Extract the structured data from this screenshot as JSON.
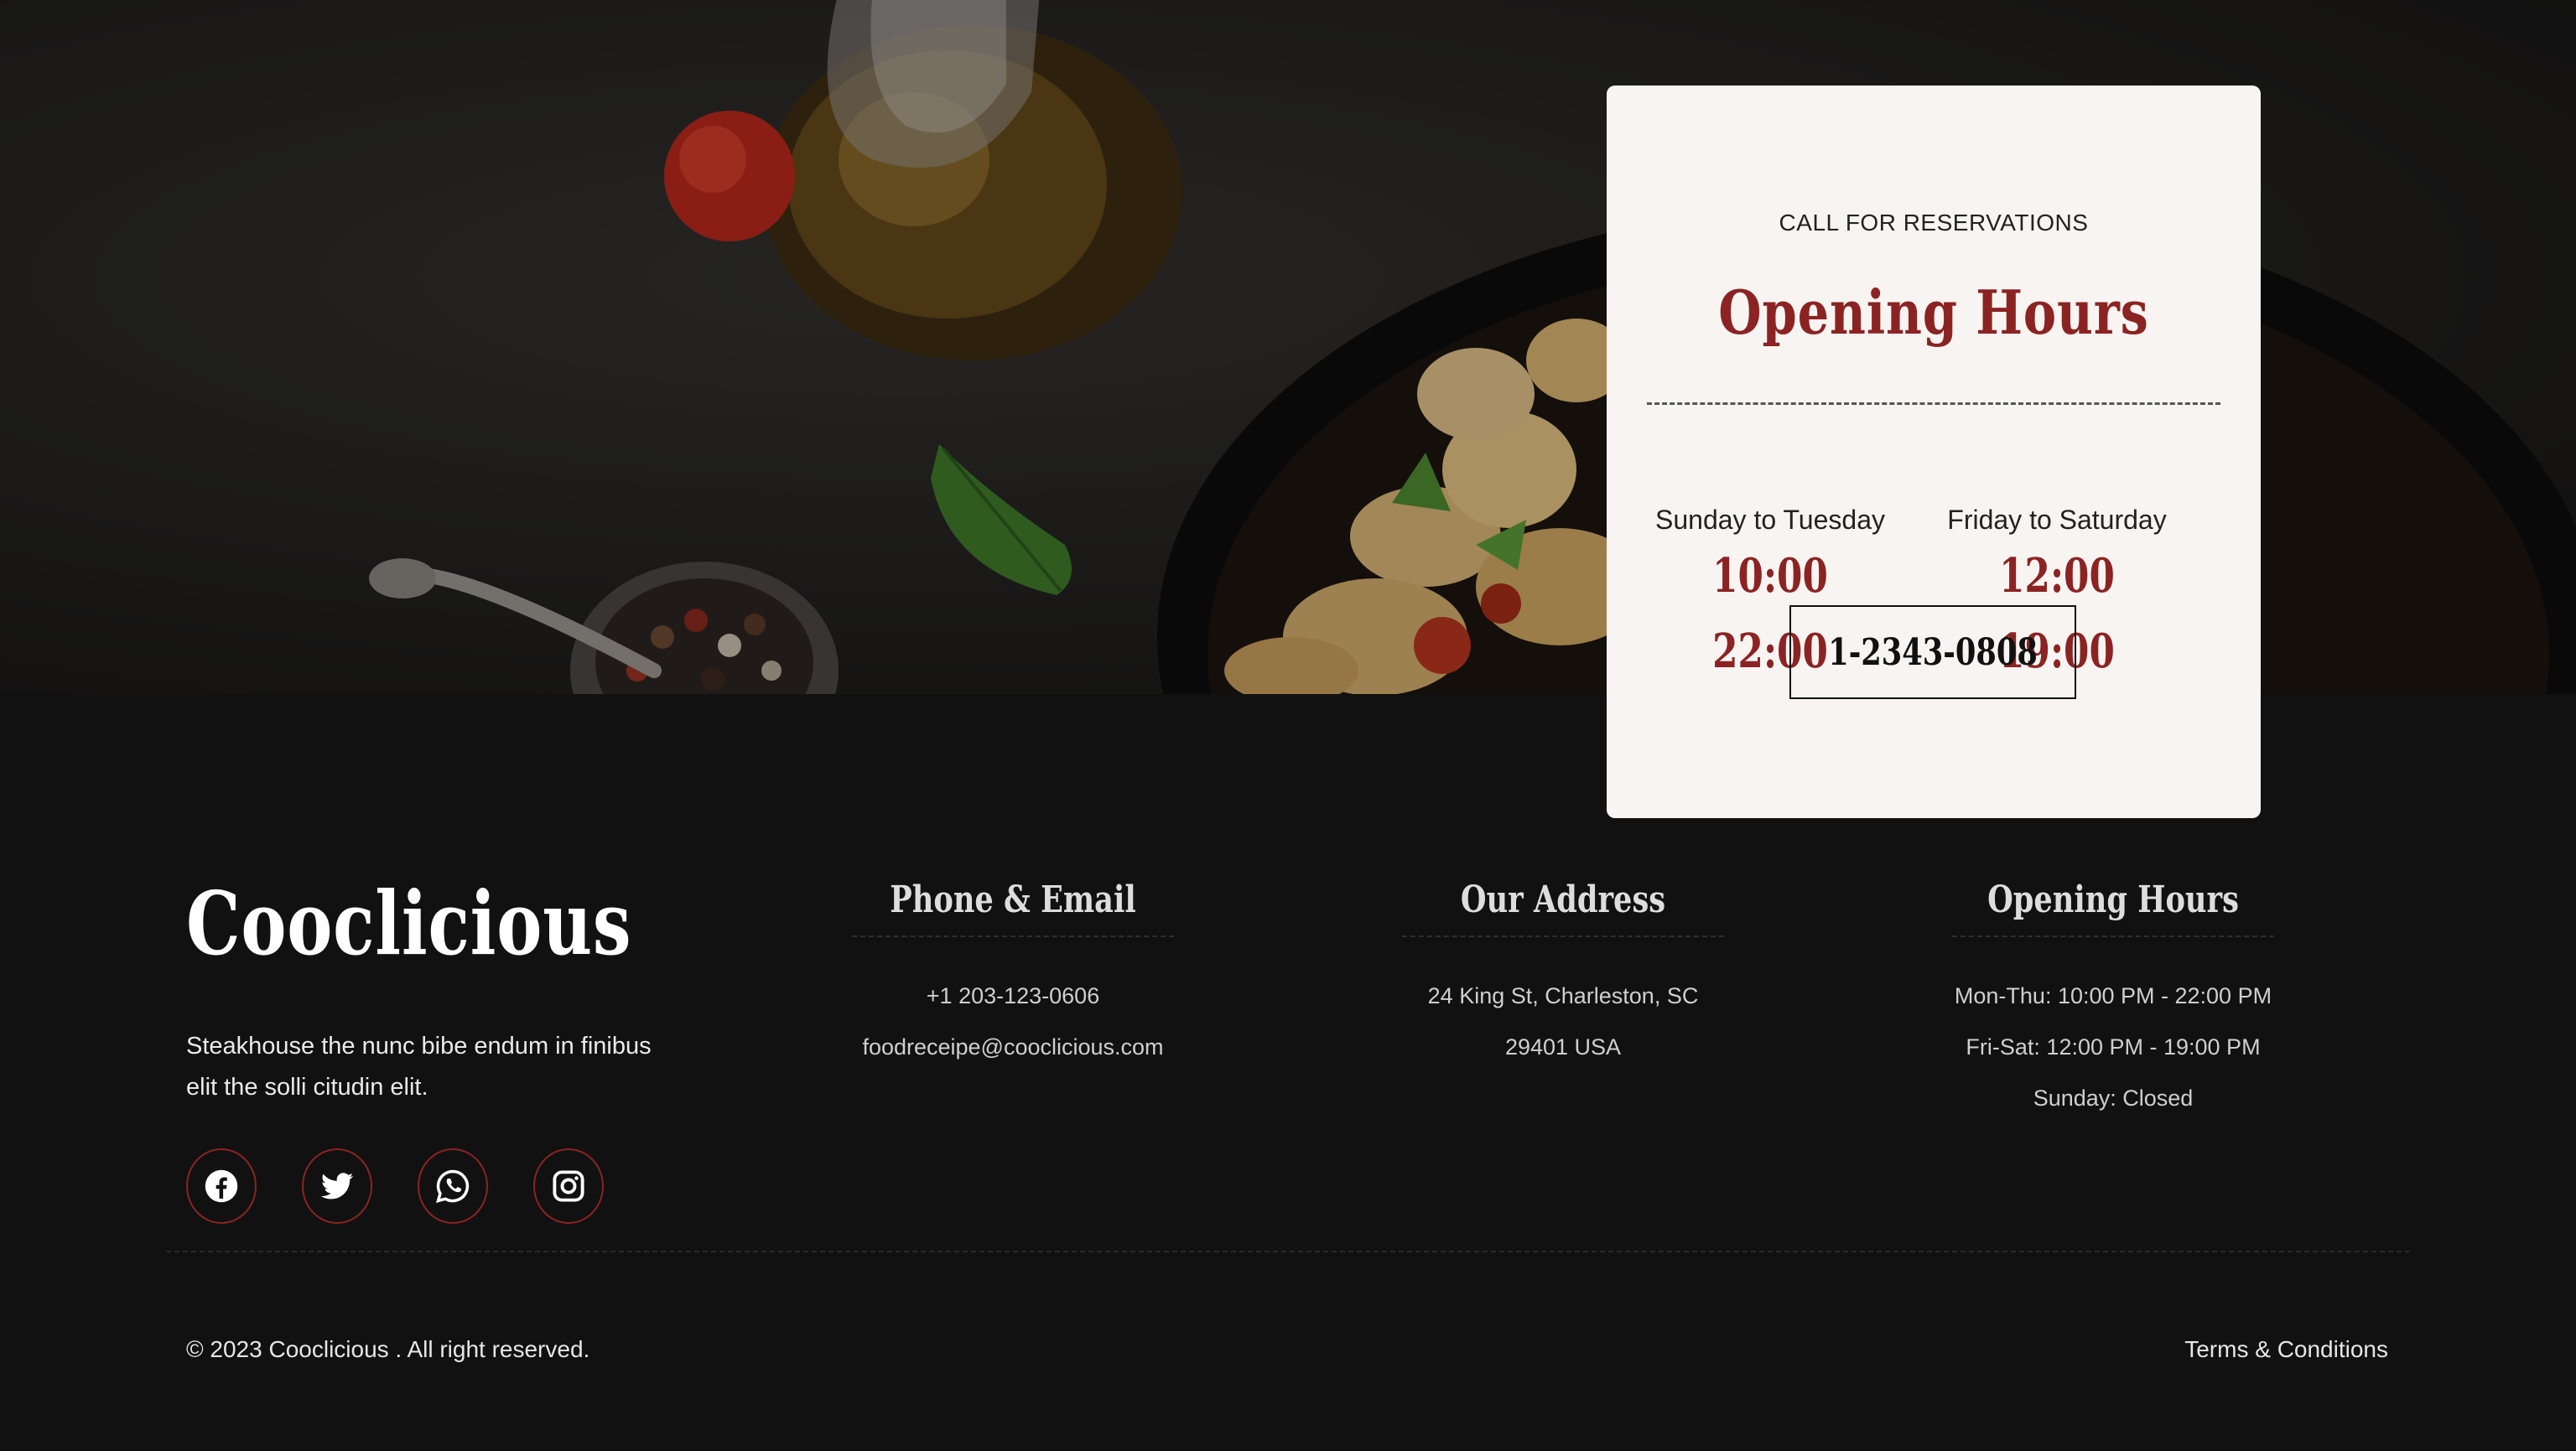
{
  "reservation": {
    "eyebrow": "CALL FOR RESERVATIONS",
    "title": "Opening Hours",
    "columns": [
      {
        "days": "Sunday to Tuesday",
        "open": "10:00",
        "close": "22:00"
      },
      {
        "days": "Friday to Saturday",
        "open": "12:00",
        "close": "19:00"
      }
    ],
    "phone": "1-2343-0808"
  },
  "brand": {
    "name": "Cooclicious",
    "description": "Steakhouse the nunc bibe endum in finibus elit the solli citudin elit."
  },
  "socials": [
    {
      "icon": "facebook-icon"
    },
    {
      "icon": "twitter-icon"
    },
    {
      "icon": "whatsapp-icon"
    },
    {
      "icon": "instagram-icon"
    }
  ],
  "contact": {
    "title": "Phone & Email",
    "phone": "+1 203-123-0606",
    "email": "foodreceipe@cooclicious.com"
  },
  "address": {
    "title": "Our Address",
    "line1": "24 King St, Charleston, SC",
    "line2": "29401 USA"
  },
  "hours": {
    "title": "Opening Hours",
    "line1": "Mon-Thu: 10:00 PM - 22:00 PM",
    "line2": "Fri-Sat: 12:00 PM - 19:00 PM",
    "line3": "Sunday: Closed"
  },
  "footer": {
    "copyright": "© 2023 Cooclicious . All right reserved.",
    "terms": "Terms & Conditions"
  },
  "colors": {
    "accent": "#8c2323",
    "background": "#111111",
    "card": "#f7f4f2"
  }
}
